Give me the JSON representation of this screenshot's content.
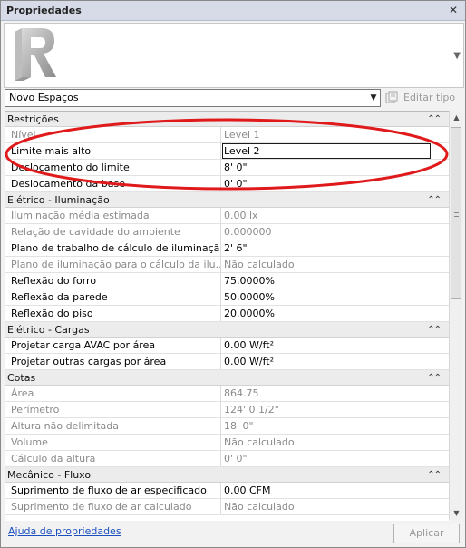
{
  "window": {
    "title": "Propriedades",
    "close_glyph": "✕"
  },
  "preview": {
    "logo_icon": "revit-r-logo-icon",
    "logo_letter": "R"
  },
  "type_selector": {
    "value": "Novo Espaços",
    "edit_type_label": "Editar tipo"
  },
  "sections": [
    {
      "title": "Restrições",
      "rows": [
        {
          "label": "Nível",
          "value": "Level 1",
          "disabled": true
        },
        {
          "label": "Limite mais alto",
          "value": "Level 2",
          "disabled": false,
          "editing": true
        },
        {
          "label": "Deslocamento do limite",
          "value": "8'  0\"",
          "disabled": false
        },
        {
          "label": "Deslocamento da base",
          "value": "0'  0\"",
          "disabled": false
        }
      ]
    },
    {
      "title": "Elétrico - Iluminação",
      "rows": [
        {
          "label": "Iluminação média estimada",
          "value": "0.00 lx",
          "disabled": true
        },
        {
          "label": "Relação de cavidade do ambiente",
          "value": "0.000000",
          "disabled": true
        },
        {
          "label": "Plano de trabalho de cálculo de iluminação",
          "value": "2'  6\"",
          "disabled": false
        },
        {
          "label": "Plano de iluminação para o cálculo da ilu...",
          "value": "Não calculado",
          "disabled": true
        },
        {
          "label": "Reflexão do forro",
          "value": "75.0000%",
          "disabled": false
        },
        {
          "label": "Reflexão da parede",
          "value": "50.0000%",
          "disabled": false
        },
        {
          "label": "Reflexão do piso",
          "value": "20.0000%",
          "disabled": false
        }
      ]
    },
    {
      "title": "Elétrico - Cargas",
      "rows": [
        {
          "label": "Projetar carga AVAC por área",
          "value": "0.00 W/ft²",
          "disabled": false
        },
        {
          "label": "Projetar outras cargas por área",
          "value": "0.00 W/ft²",
          "disabled": false
        }
      ]
    },
    {
      "title": "Cotas",
      "rows": [
        {
          "label": "Área",
          "value": "864.75",
          "disabled": true
        },
        {
          "label": "Perímetro",
          "value": "124'  0 1/2\"",
          "disabled": true
        },
        {
          "label": "Altura não delimitada",
          "value": "18'  0\"",
          "disabled": true
        },
        {
          "label": "Volume",
          "value": "Não calculado",
          "disabled": true
        },
        {
          "label": "Cálculo da altura",
          "value": "0'  0\"",
          "disabled": true
        }
      ]
    },
    {
      "title": "Mecânico - Fluxo",
      "rows": [
        {
          "label": "Suprimento de fluxo de ar especificado",
          "value": "0.00 CFM",
          "disabled": false
        },
        {
          "label": "Suprimento de fluxo de ar calculado",
          "value": "Não calculado",
          "disabled": true
        }
      ]
    }
  ],
  "footer": {
    "help_link": "Ajuda de propriedades",
    "apply_label": "Aplicar"
  },
  "colors": {
    "annotation": "#e0191b",
    "link": "#1c4fbd"
  }
}
